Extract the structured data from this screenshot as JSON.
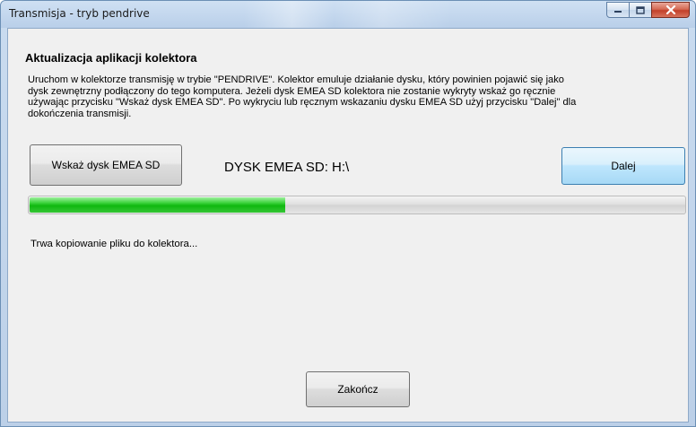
{
  "window": {
    "title": "Transmisja - tryb pendrive",
    "min_icon": "minimize-icon",
    "max_icon": "maximize-icon",
    "close_icon": "close-icon"
  },
  "content": {
    "heading": "Aktualizacja aplikacji kolektora",
    "description": [
      "Uruchom w kolektorze transmisję w trybie \"PENDRIVE\". Kolektor emuluje działanie dysku, który powinien pojawić się jako",
      "dysk zewnętrzny podłączony do tego komputera.  Jeżeli dysk EMEA SD kolektora nie zostanie wykryty wskaż go ręcznie",
      "używając przycisku \"Wskaż dysk EMEA SD\". Po wykryciu lub ręcznym wskazaniu dysku EMEA SD użyj przycisku \"Dalej\" dla",
      "dokończenia transmisji."
    ],
    "select_disk_button": "Wskaż dysk EMEA SD",
    "disk_label": "DYSK EMEA SD:  H:\\",
    "next_button": "Dalej",
    "progress_value": 0.39,
    "status_text": "Trwa kopiowanie pliku do kolektora...",
    "finish_button": "Zakończ"
  },
  "colors": {
    "progress_fill": "#1ec41e",
    "next_button_accent": "#bee6fd",
    "close_button": "#c2402a"
  }
}
